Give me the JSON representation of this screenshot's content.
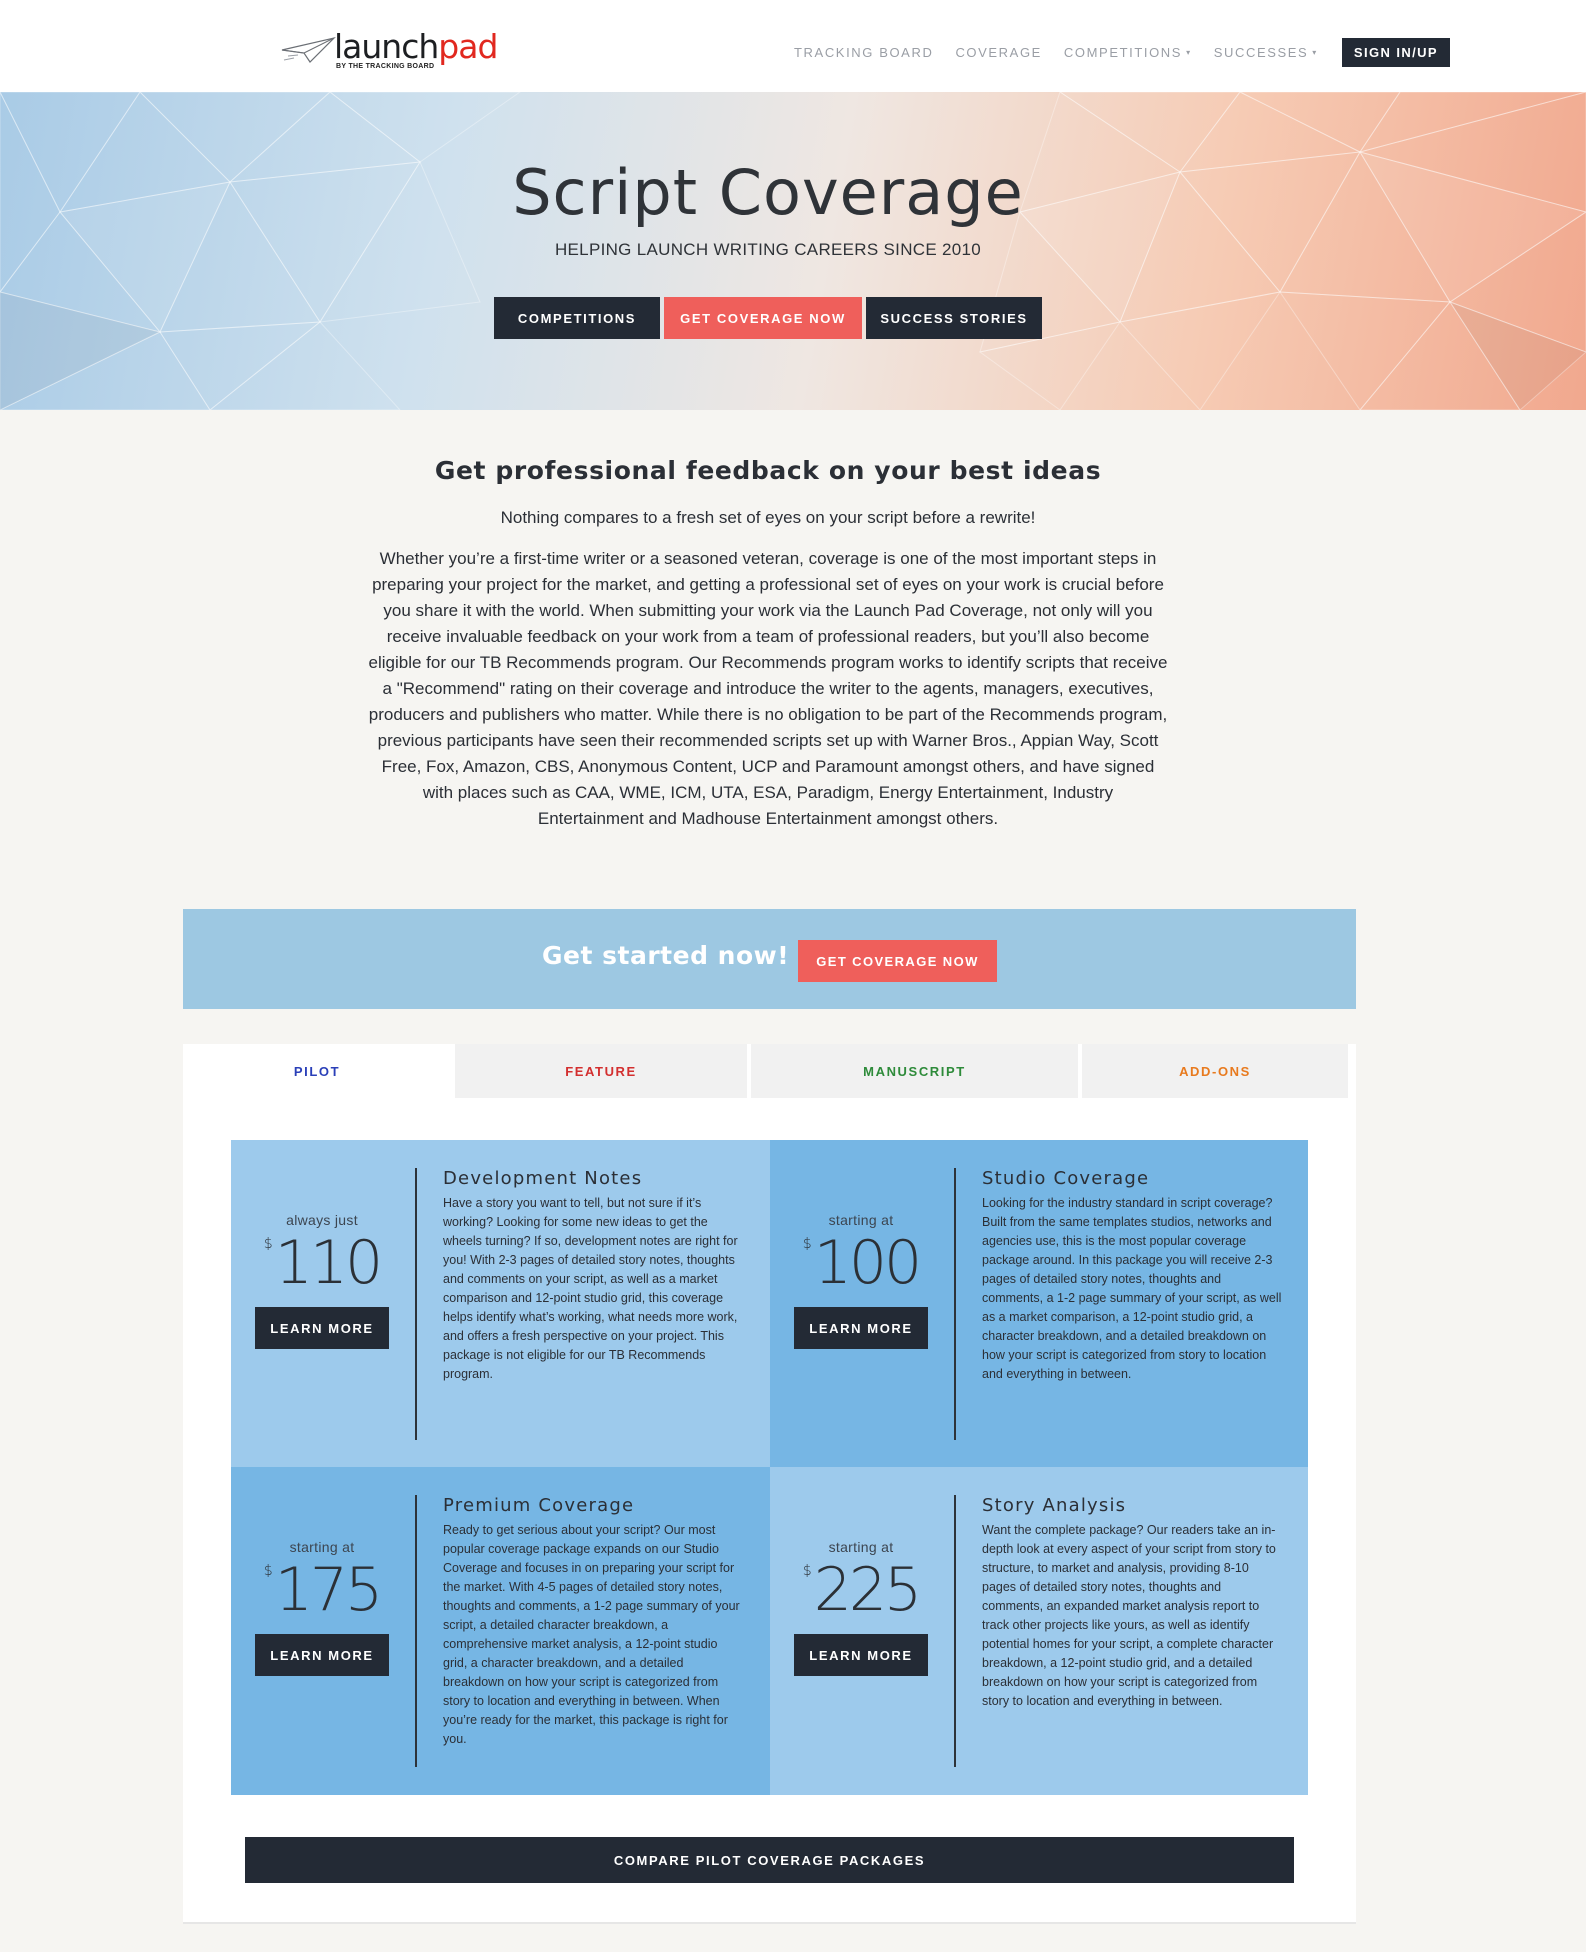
{
  "header": {
    "logo": {
      "word_launch": "launch",
      "word_pad": "pad",
      "tagline": "BY THE TRACKING BOARD"
    },
    "nav": [
      {
        "label": "TRACKING BOARD"
      },
      {
        "label": "COVERAGE"
      },
      {
        "label": "COMPETITIONS",
        "caret": "▾"
      },
      {
        "label": "SUCCESSES",
        "caret": "▾"
      }
    ],
    "signin_label": "SIGN IN/UP"
  },
  "hero": {
    "title": "Script Coverage",
    "subtitle": "HELPING LAUNCH WRITING CAREERS SINCE 2010",
    "buttons": {
      "competitions": "COMPETITIONS",
      "get_coverage": "GET COVERAGE NOW",
      "success_stories": "SUCCESS STORIES"
    }
  },
  "intro": {
    "heading": "Get professional feedback on your best ideas",
    "lead": "Nothing compares to a fresh set of eyes on your script before a rewrite!",
    "body": "Whether you’re a first-time writer or a seasoned veteran, coverage is one of the most important steps in preparing your project for the market, and getting a professional set of eyes on your work is crucial before you share it with the world. When submitting your work via the Launch Pad Coverage, not only will you receive invaluable feedback on your work from a team of professional readers, but you’ll also become eligible for our TB Recommends program. Our Recommends program works to identify scripts that receive a \"Recommend\" rating on their coverage and introduce the writer to the agents, managers, executives, producers and publishers who matter. While there is no obligation to be part of the Recommends program, previous participants have seen their recommended scripts set up with Warner Bros., Appian Way, Scott Free, Fox, Amazon, CBS, Anonymous Content, UCP and Paramount amongst others, and have signed with places such as CAA, WME, ICM, UTA, ESA, Paradigm, Energy Entertainment, Industry Entertainment and Madhouse Entertainment amongst others."
  },
  "get_started": {
    "text": "Get started now!",
    "button": "GET COVERAGE NOW"
  },
  "tabs": [
    {
      "label": "PILOT",
      "color": "#2a3fb8",
      "active": true
    },
    {
      "label": "FEATURE",
      "color": "#d32f2f",
      "active": false
    },
    {
      "label": "MANUSCRIPT",
      "color": "#2e8b3a",
      "active": false
    },
    {
      "label": "ADD-ONS",
      "color": "#e87a1e",
      "active": false
    }
  ],
  "packages": [
    {
      "prefix": "always just",
      "currency": "$",
      "price": "110",
      "button": "LEARN MORE",
      "title": "Development Notes",
      "body": "Have a story you want to tell, but not sure if it’s working? Looking for some new ideas to get the wheels turning? If so, development notes are right for you! With 2-3 pages of detailed story notes, thoughts and comments on your script, as well as a market comparison and 12-point studio grid, this coverage helps identify what’s working, what needs more work, and offers a fresh perspective on your project. This package is not eligible for our TB Recommends program."
    },
    {
      "prefix": "starting at",
      "currency": "$",
      "price": "100",
      "button": "LEARN MORE",
      "title": "Studio Coverage",
      "body": "Looking for the industry standard in script coverage? Built from the same templates studios, networks and agencies use, this is the most popular coverage package around. In this package you will receive 2-3 pages of detailed story notes, thoughts and comments, a 1-2 page summary of your script, as well as a market comparison, a 12-point studio grid, a character breakdown, and a detailed breakdown on how your script is categorized from story to location and everything in between."
    },
    {
      "prefix": "starting at",
      "currency": "$",
      "price": "175",
      "button": "LEARN MORE",
      "title": "Premium Coverage",
      "body": "Ready to get serious about your script? Our most popular coverage package expands on our Studio Coverage and focuses in on preparing your script for the market. With 4-5 pages of detailed story notes, thoughts and comments, a 1-2 page summary of your script, a detailed character breakdown, a comprehensive market analysis, a 12-point studio grid, a character breakdown, and a detailed breakdown on how your script is categorized from story to location and everything in between. When you’re ready for the market, this package is right for you."
    },
    {
      "prefix": "starting at",
      "currency": "$",
      "price": "225",
      "button": "LEARN MORE",
      "title": "Story Analysis",
      "body": "Want the complete package? Our readers take an in-depth look at every aspect of your script from story to structure, to market and analysis, providing 8-10 pages of detailed story notes, thoughts and comments, an expanded market analysis report to track other projects like yours, as well as identify potential homes for your script, a complete character breakdown, a 12-point studio grid, and a detailed breakdown on how your script is categorized from story to location and everything in between."
    }
  ],
  "compare_button": "COMPARE PILOT COVERAGE PACKAGES",
  "colors": {
    "dark": "#232a35",
    "accent_red": "#ef5f5b",
    "banner_blue": "#9dc8e2",
    "card_light": "#9dcaec",
    "card_mid": "#76b6e4"
  }
}
